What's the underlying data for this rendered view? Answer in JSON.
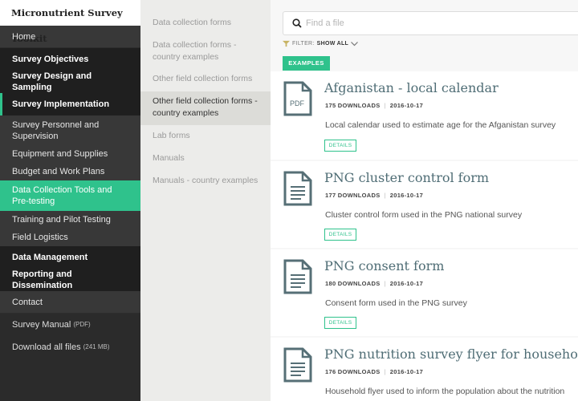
{
  "brand": "Micronutrient Survey Toolkit",
  "nav": {
    "home": "Home",
    "objectives": "Survey Objectives",
    "design": "Survey Design and Sampling",
    "implementation": "Survey Implementation",
    "sub": [
      "Survey Personnel and Supervision",
      "Equipment and Supplies",
      "Budget and Work Plans",
      "Data Collection Tools and Pre-testing",
      "Training and Pilot Testing",
      "Field Logistics"
    ],
    "data_management": "Data Management",
    "reporting": "Reporting and Dissemination",
    "contact": "Contact",
    "manual": "Survey Manual",
    "manual_note": "(PDF)",
    "download": "Download all files",
    "download_note": "(241 MB)"
  },
  "subnav": [
    "Data collection forms",
    "Data collection forms - country examples",
    "Other field collection forms",
    "Other field collection forms - country examples",
    "Lab forms",
    "Manuals",
    "Manuals - country examples"
  ],
  "search": {
    "placeholder": "Find a file"
  },
  "filter": {
    "label": "FILTER:",
    "value": "SHOW ALL"
  },
  "tag": "EXAMPLES",
  "details_label": "DETAILS",
  "files": [
    {
      "title": "Afganistan - local calendar",
      "downloads": "175 DOWNLOADS",
      "date": "2016-10-17",
      "desc": "Local calendar used to estimate age for the Afganistan survey",
      "icon": "pdf-icon",
      "icon_label": "PDF"
    },
    {
      "title": "PNG cluster control form",
      "downloads": "177 DOWNLOADS",
      "date": "2016-10-17",
      "desc": "Cluster control form used in the PNG national survey",
      "icon": "document-icon"
    },
    {
      "title": "PNG consent form",
      "downloads": "180 DOWNLOADS",
      "date": "2016-10-17",
      "desc": "Consent form used in the PNG survey",
      "icon": "document-icon"
    },
    {
      "title": "PNG nutrition survey flyer for households",
      "downloads": "176 DOWNLOADS",
      "date": "2016-10-17",
      "desc": "Household flyer used to inform the population about the nutrition",
      "icon": "document-icon"
    }
  ],
  "colors": {
    "accent": "#2fc28c",
    "nav_bg": "#2b2b2b",
    "title": "#4f6d75"
  }
}
